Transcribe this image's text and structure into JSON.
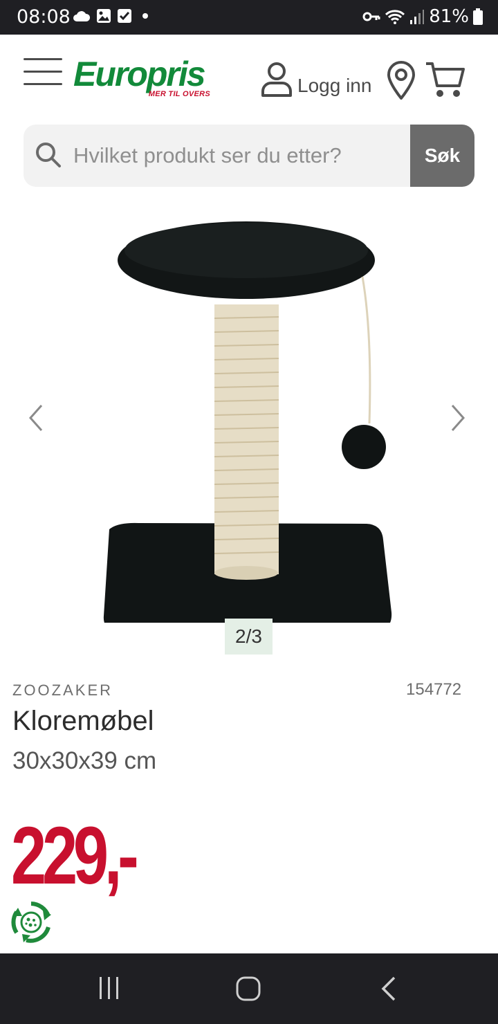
{
  "status_bar": {
    "time": "08:08",
    "battery": "81%",
    "icons": [
      "cloud-icon",
      "gallery-icon",
      "checkbox-icon",
      "dot-icon",
      "key-icon",
      "wifi-icon",
      "signal-icon",
      "battery-icon"
    ]
  },
  "header": {
    "logo_text": "Europris",
    "logo_tagline": "MER TIL OVERS",
    "login_label": "Logg inn"
  },
  "search": {
    "placeholder": "Hvilket produkt ser du etter?",
    "button_label": "Søk"
  },
  "gallery": {
    "counter": "2/3"
  },
  "product": {
    "brand": "ZOOZAKER",
    "sku": "154772",
    "title": "Kloremøbel",
    "size": "30x30x39 cm",
    "price": "229,-"
  },
  "colors": {
    "brand_green": "#128a3a",
    "price_red": "#c8102e",
    "system_bar": "#1f1f23",
    "search_button": "#6b6b6b"
  }
}
